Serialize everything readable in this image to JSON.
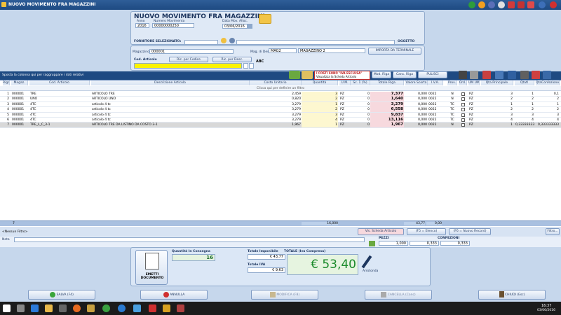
{
  "window": {
    "title": "NUOVO MOVIMENTO FRA MAGAZZINI"
  },
  "header": {
    "title": "NUOVO MOVIMENTO FRA MAGAZZINI",
    "anno_label": "Anno",
    "anno": "2016",
    "numero_label": "Numero Movimento",
    "numero": "00000000250",
    "data_label": "Data Mov. Alloc.",
    "data": "03/06/2016",
    "fornitore_label": "FORNITORE SELEZIONATO:",
    "oggetto_label": "OGGETTO",
    "magazzino_label": "Magazzino",
    "magazzino_code": "000001",
    "mag_dest_label": "Mag. di Dest.",
    "mag_dest_code": "MAG2",
    "mag_dest_name": "MAGAZZINO 2",
    "importa_label": "IMPORTA DA TERMINALE",
    "cod_articolo_label": "Cod. Articolo",
    "ric_codice_label": "Ric. per Codice",
    "ric_desc_label": "Ric. per Desc.",
    "abc_label": "ABC"
  },
  "toolbar": {
    "group_hint": "Sposta la colonna qui per raggruppare i dati relativi",
    "iva_label": "I COSTI SONO \"IVA ESCLUSA\"",
    "scheda_label": "Visualizza la Scheda Articolo",
    "mod_riga": "Mod. Riga",
    "canc_riga": "Canc. Riga",
    "pulisci": "PULISCI"
  },
  "grid": {
    "filter_hint": "Clicca qui per definire un filtro",
    "columns": [
      "Riga",
      "Magaz.",
      "Cod. Articolo",
      "Descrizione Articolo",
      "Costo Unitario",
      "Quantità",
      "U.M.",
      "Sc. 1 (%)",
      "Totale Riga",
      "Valore Scorta",
      "I.V.A.",
      "Prov.",
      "Ord.",
      "UM UM",
      "Qta Principale",
      "Qtatl",
      "QtaConfezione"
    ],
    "rows": [
      {
        "riga": "1",
        "mag": "000001",
        "cod": "TRE",
        "desc": "ARTICOLO TRE",
        "costo": "2,459",
        "qta": "3",
        "um": "PZ",
        "sc": "0",
        "tot": "7,377",
        "val": "0,000",
        "iva": "0022",
        "prov": "N",
        "um2": "PZ",
        "qp": "3",
        "qt": "1",
        "qc": "0,1"
      },
      {
        "riga": "2",
        "mag": "000001",
        "cod": "UNO",
        "desc": "ARTICOLO UNO",
        "costo": "0,820",
        "qta": "2",
        "um": "PZ",
        "sc": "0",
        "tot": "1,640",
        "val": "0,000",
        "iva": "0022",
        "prov": "N",
        "um2": "PZ",
        "qp": "2",
        "qt": "2",
        "qc": "2"
      },
      {
        "riga": "3",
        "mag": "000001",
        "cod": "4TC",
        "desc": "articolo 4 tc",
        "costo": "3,279",
        "qta": "1",
        "um": "PZ",
        "sc": "0",
        "tot": "3,279",
        "val": "0,000",
        "iva": "0022",
        "prov": "TC",
        "um2": "PZ",
        "qp": "1",
        "qt": "1",
        "qc": "1"
      },
      {
        "riga": "4",
        "mag": "000001",
        "cod": "4TC",
        "desc": "articolo 4 tc",
        "costo": "3,279",
        "qta": "2",
        "um": "PZ",
        "sc": "0",
        "tot": "6,558",
        "val": "0,000",
        "iva": "0022",
        "prov": "TC",
        "um2": "PZ",
        "qp": "2",
        "qt": "2",
        "qc": "2"
      },
      {
        "riga": "5",
        "mag": "000001",
        "cod": "4TC",
        "desc": "articolo 4 tc",
        "costo": "3,279",
        "qta": "3",
        "um": "PZ",
        "sc": "0",
        "tot": "9,837",
        "val": "0,000",
        "iva": "0022",
        "prov": "TC",
        "um2": "PZ",
        "qp": "3",
        "qt": "3",
        "qc": "3"
      },
      {
        "riga": "6",
        "mag": "000001",
        "cod": "4TC",
        "desc": "articolo 4 tc",
        "costo": "3,279",
        "qta": "4",
        "um": "PZ",
        "sc": "0",
        "tot": "13,116",
        "val": "0,000",
        "iva": "0022",
        "prov": "TC",
        "um2": "PZ",
        "qp": "4",
        "qt": "4",
        "qc": "4"
      },
      {
        "riga": "7",
        "mag": "000001",
        "cod": "TRE_L_C_3-1",
        "desc": "ARTICOLO TRE DA LISTINO DA COSTO 3-1",
        "costo": "1,967",
        "qta": "1",
        "um": "PZ",
        "sc": "0",
        "tot": "1,967",
        "val": "0,000",
        "iva": "0022",
        "prov": "N",
        "um2": "PZ",
        "qp": "1",
        "qt": "0,333333333",
        "qc": "0,333333333"
      }
    ],
    "footer_count": "7",
    "footer_qta": "16,000",
    "footer_tot": "43,77",
    "footer_val": "0,00"
  },
  "bottombar": {
    "filter_none": "<Nessun Filtro>",
    "scheda_btn": "Vis. Scheda Articolo",
    "f5": "(F5 = Elenco)",
    "f6": "(F6 = Nuovo Record)",
    "filtro": "Filtro...",
    "nota_label": "Nota",
    "pezzi_label": "PEZZI",
    "confezioni_label": "CONFEZIONI",
    "pezzi_val": "1,000",
    "pezzi_val2": "0,333",
    "conf_val": "0,333"
  },
  "totals": {
    "emetti_label": "EMETTI DOCUMENTO",
    "qta_label": "Quantità In Consegna",
    "qta_val": "16",
    "imponibile_label": "Totale Imponibile",
    "imponibile_val": "€ 43,77",
    "iva_label": "Totale IVA",
    "iva_val": "€ 9,63",
    "totale_label": "TOTALE (Iva Compresa)",
    "totale_val": "€ 53,40",
    "arrotonda": "Arrotonda"
  },
  "actions": {
    "salva": "SALVA (F4)",
    "annulla": "ANNULLA",
    "modifica": "MODIFICA (F8)",
    "cancella": "CANCELLA (Canc)",
    "chiudi": "CHIUDI (Esc)"
  },
  "taskbar": {
    "time": "16:37",
    "date": "03/06/2016"
  },
  "colors": {
    "accent": "#1e4a82",
    "green_total": "#1a8a2a",
    "pink": "#f7d9de"
  }
}
